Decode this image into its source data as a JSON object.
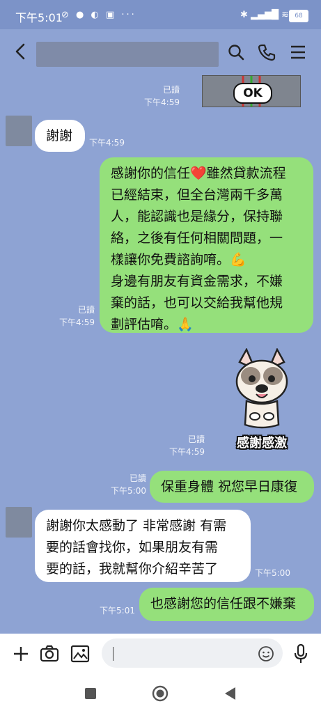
{
  "status": {
    "time": "下午5:01",
    "battery": "68"
  },
  "header": {
    "title": ""
  },
  "messages": [
    {
      "id": "m1",
      "kind": "sticker",
      "sticker": "ok-sticker",
      "sticker_text": "OK",
      "side": "out",
      "read": "已讀",
      "time": "下午4:59"
    },
    {
      "id": "m2",
      "kind": "text",
      "side": "in",
      "text": "謝謝",
      "time": "下午4:59"
    },
    {
      "id": "m3",
      "kind": "text",
      "side": "out",
      "lines": [
        "感謝你的信任❤️雖然貸款流程",
        "已經結束，但全台灣兩千多萬",
        "人，能認識也是緣分，保持聯",
        "絡，之後有任何相關問題，一",
        "樣讓你免費諮詢唷。💪",
        "身邊有朋友有資金需求，不嫌",
        "棄的話，也可以交給我幫他規",
        "劃評估唷。🙏"
      ],
      "read": "已讀",
      "time": "下午4:59"
    },
    {
      "id": "m4",
      "kind": "sticker",
      "sticker": "dog-sticker",
      "sticker_text": "感謝感激",
      "side": "out",
      "read": "已讀",
      "time": "下午4:59"
    },
    {
      "id": "m5",
      "kind": "text",
      "side": "out",
      "text": "保重身體 祝您早日康復",
      "read": "已讀",
      "time": "下午5:00"
    },
    {
      "id": "m6",
      "kind": "text",
      "side": "in",
      "lines": [
        "謝謝你太感動了 非常感謝 有需",
        "要的話會找你，如果朋友有需",
        "要的話，我就幫你介紹辛苦了"
      ],
      "time": "下午5:00"
    },
    {
      "id": "m7",
      "kind": "text",
      "side": "out",
      "text": "也感謝您的信任跟不嫌棄",
      "time": "下午5:01"
    }
  ],
  "input": {
    "value": "",
    "placeholder": ""
  },
  "colors": {
    "chat_bg": "#8ea3d3",
    "bubble_out": "#95e07b",
    "bubble_in": "#ffffff"
  }
}
